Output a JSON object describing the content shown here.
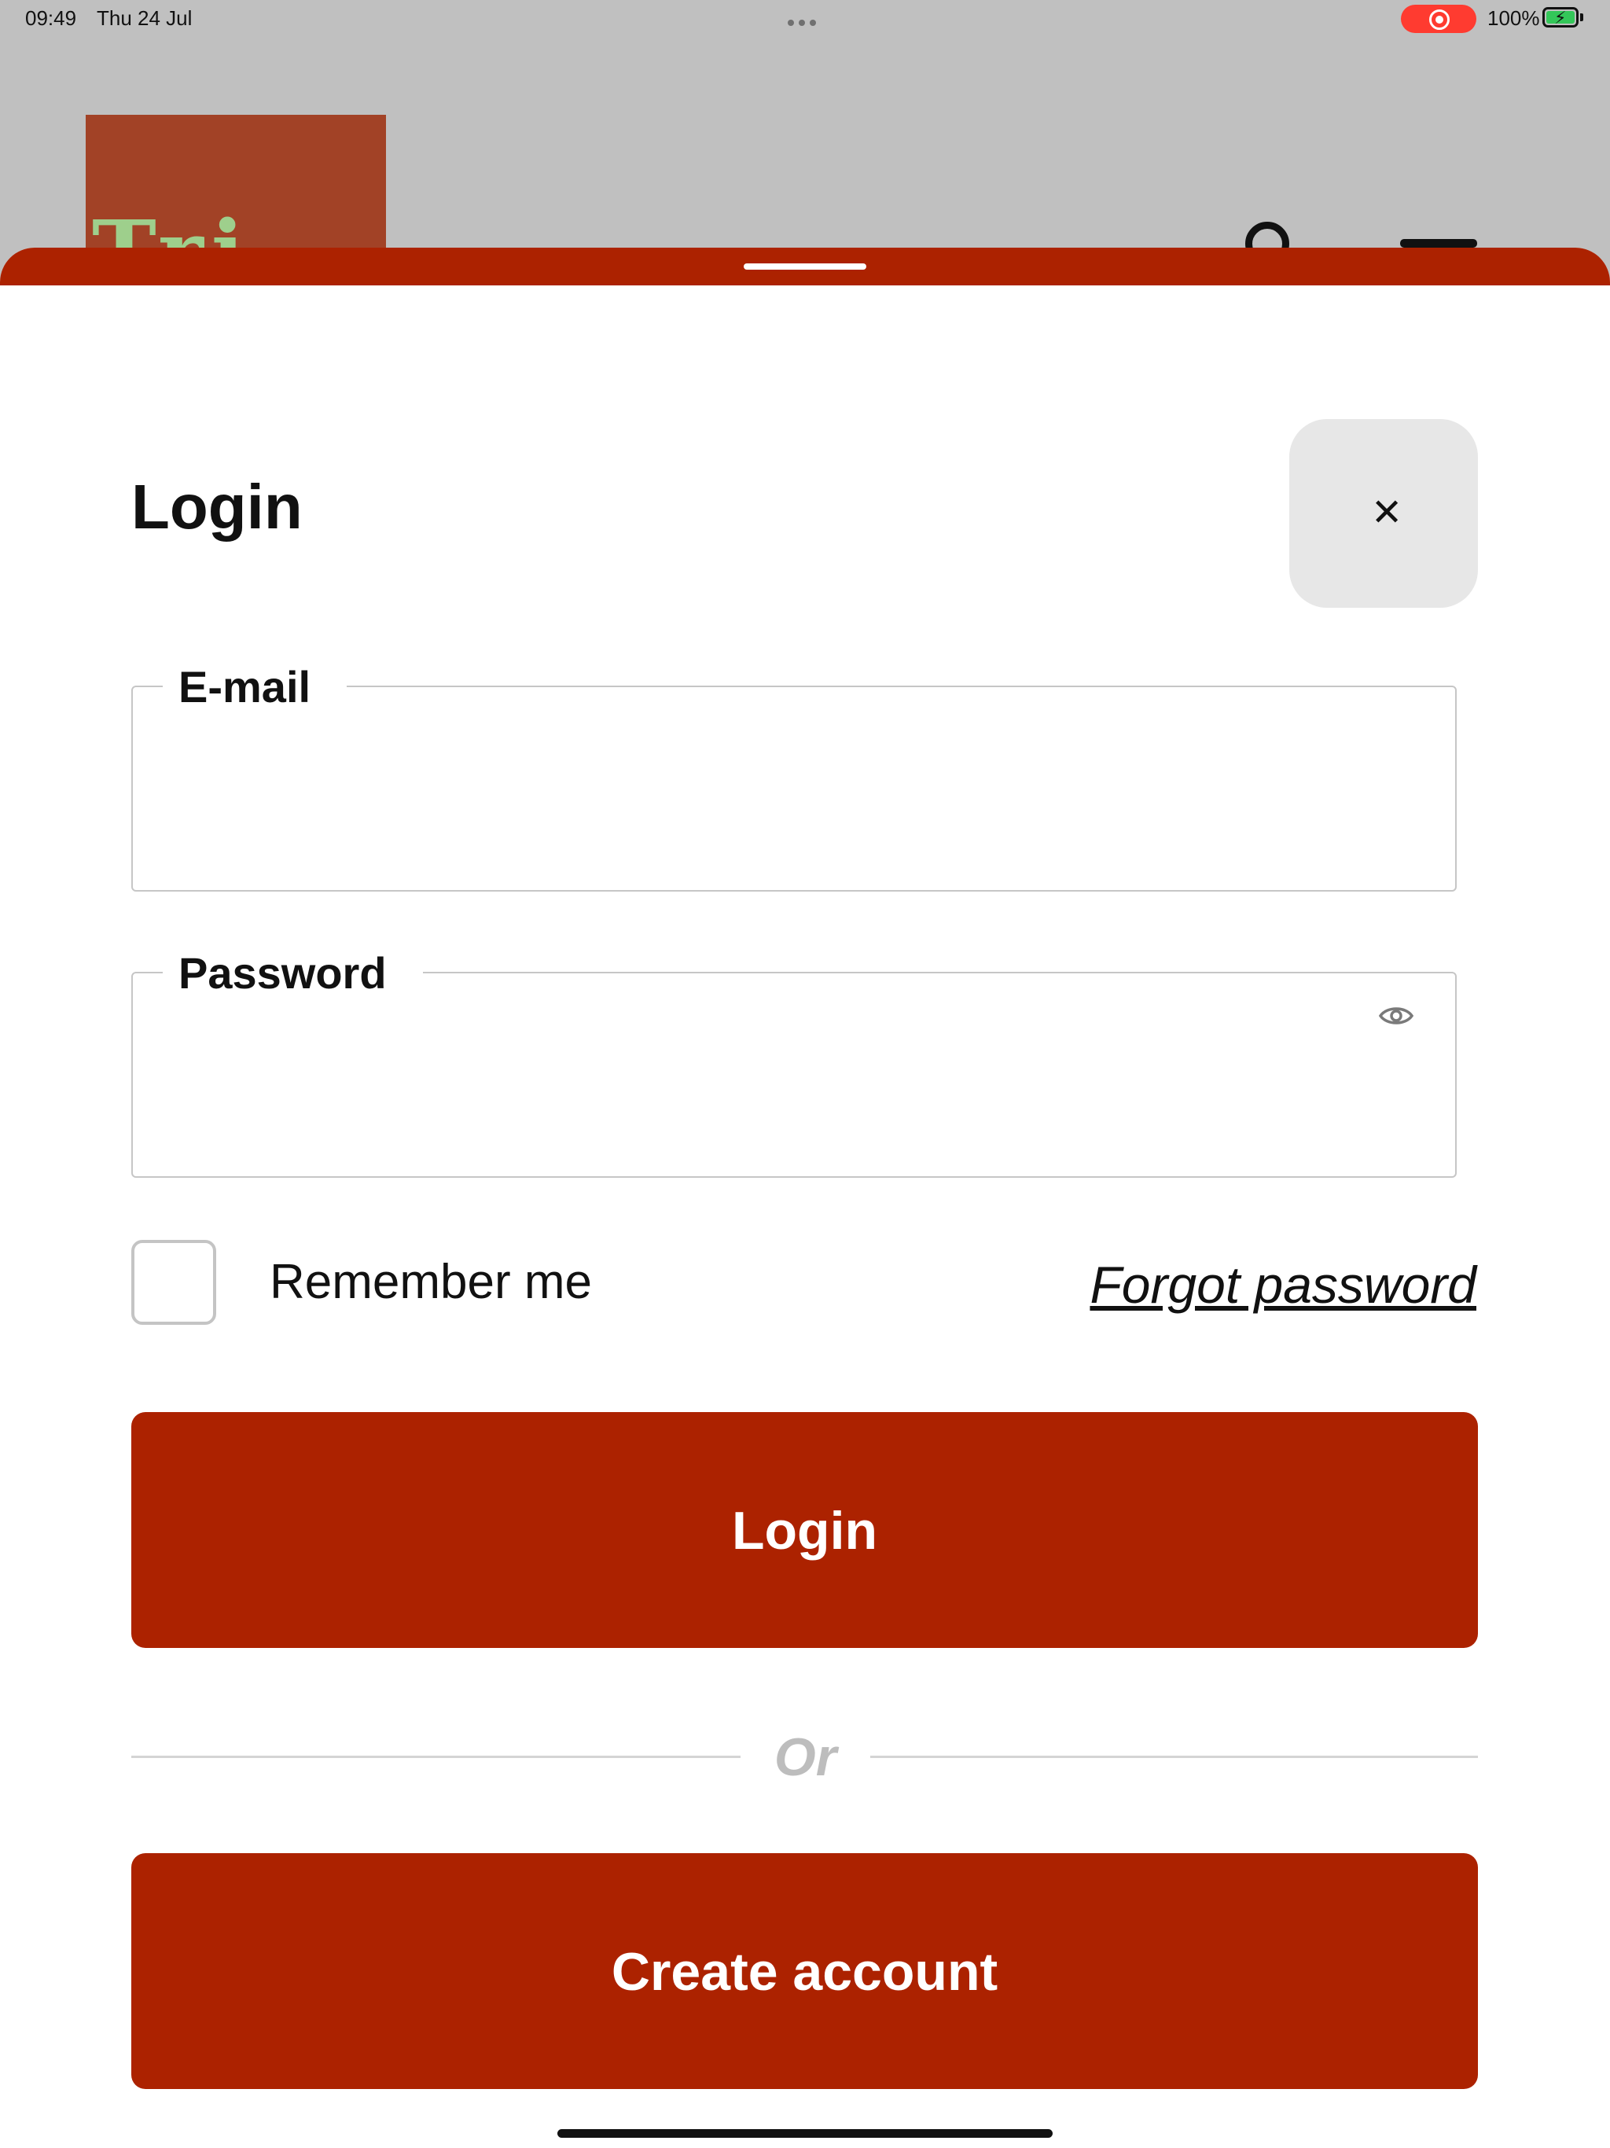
{
  "status_bar": {
    "time": "09:49",
    "date": "Thu 24 Jul",
    "battery_percent": "100%",
    "recording_indicator_color": "#ff3b30",
    "battery_color": "#34c759"
  },
  "background_page": {
    "logo_color": "#a24226",
    "icons": [
      "user-icon",
      "menu-icon"
    ]
  },
  "login_sheet": {
    "title": "Login",
    "close_icon": "✕",
    "email": {
      "label": "E-mail",
      "value": ""
    },
    "password": {
      "label": "Password",
      "value": "",
      "toggle_icon": "eye-icon"
    },
    "remember_me": {
      "label": "Remember me",
      "checked": false
    },
    "forgot_password_label": "Forgot password",
    "login_button_label": "Login",
    "divider_text": "Or",
    "create_account_button_label": "Create account",
    "accent_color": "#ac2200"
  }
}
